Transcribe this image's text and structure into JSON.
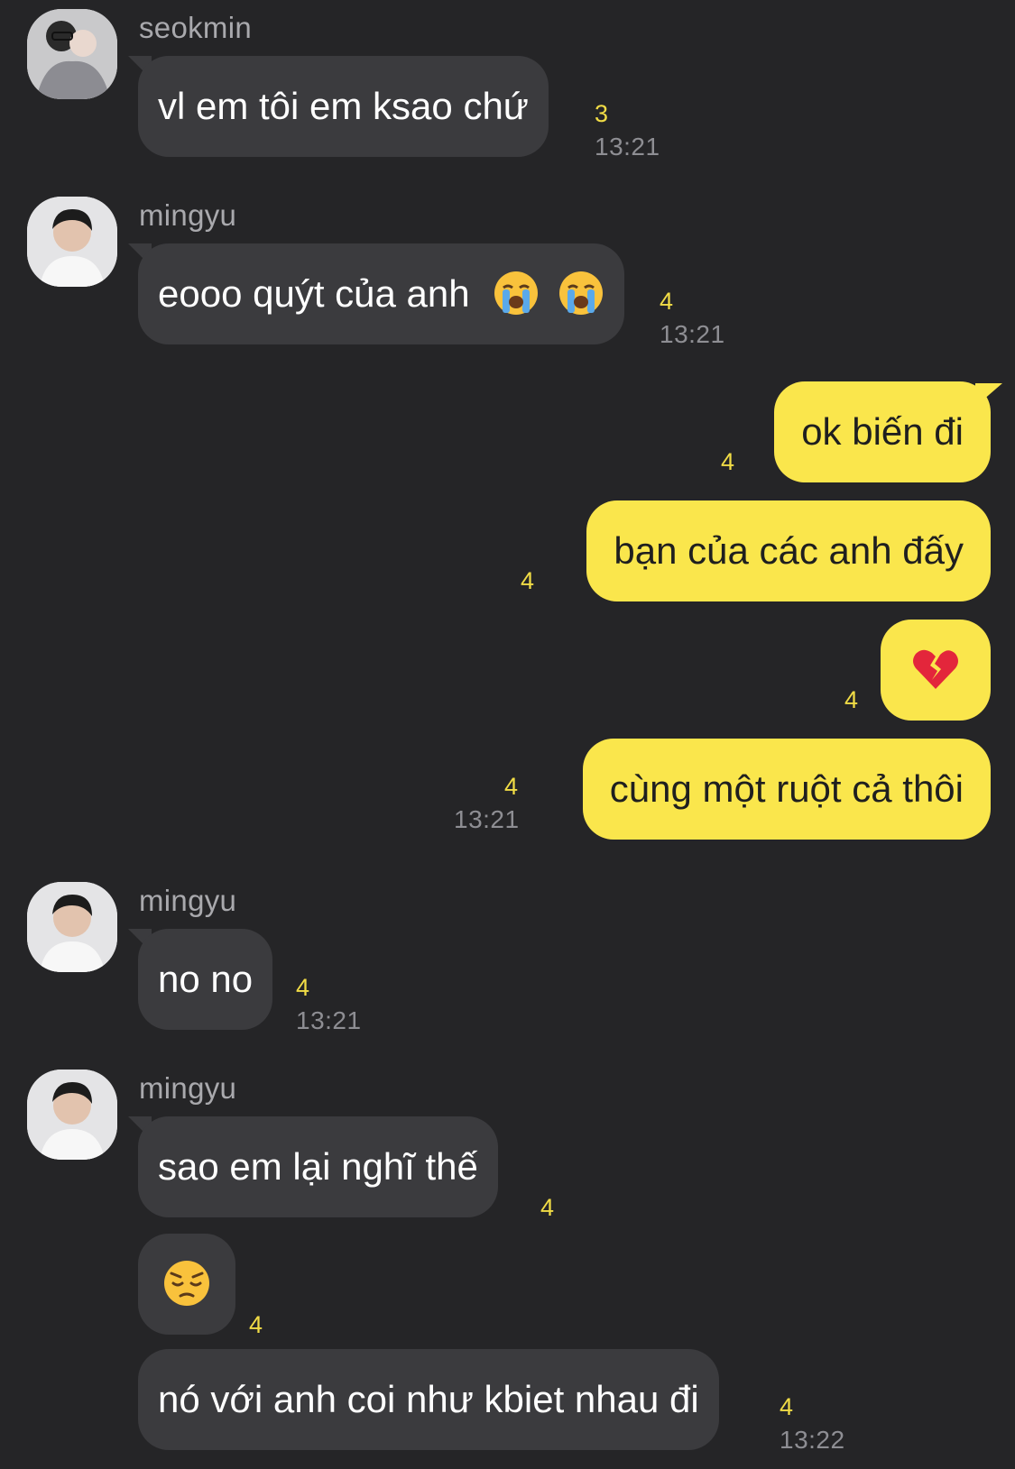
{
  "messages": [
    {
      "sender": "seokmin",
      "text": "vl em tôi em ksao chứ",
      "unread": "3",
      "time": "13:21"
    },
    {
      "sender": "mingyu",
      "text": "eooo quýt của anh",
      "emoji": [
        "loudly-crying-face",
        "loudly-crying-face"
      ],
      "unread": "4",
      "time": "13:21"
    },
    {
      "text": "ok biến đi",
      "unread": "4"
    },
    {
      "text": "bạn của các anh đấy",
      "unread": "4"
    },
    {
      "emoji": "broken-heart",
      "unread": "4"
    },
    {
      "text": "cùng một ruột cả thôi",
      "unread": "4",
      "time": "13:21"
    },
    {
      "sender": "mingyu",
      "text": "no no",
      "unread": "4",
      "time": "13:21"
    },
    {
      "sender": "mingyu",
      "text": "sao em lại nghĩ thế",
      "unread": "4"
    },
    {
      "emoji": "pensive-face",
      "unread": "4"
    },
    {
      "text": "nó với anh coi như kbiet nhau đi",
      "unread": "4",
      "time": "13:22"
    }
  ],
  "colors": {
    "background": "#252527",
    "incoming_bubble": "#3b3b3e",
    "outgoing_bubble": "#fae64c",
    "unread_count": "#f1dc46",
    "timestamp": "#8e8e93",
    "sender_name": "#a9a9ad"
  }
}
